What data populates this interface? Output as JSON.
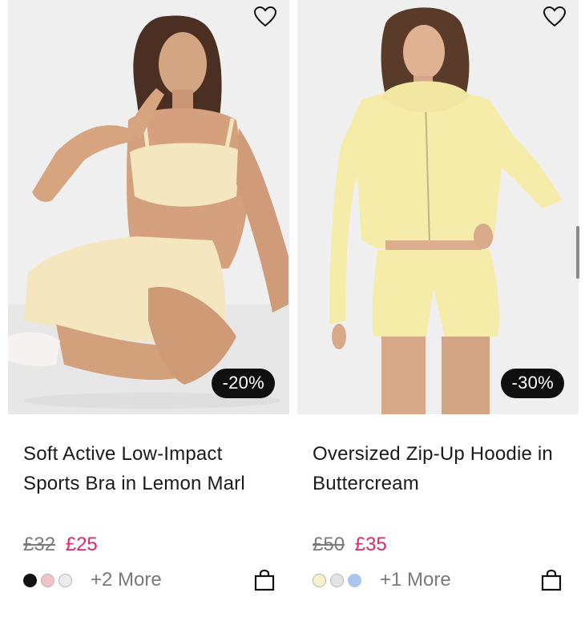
{
  "products": [
    {
      "title": "Soft Active Low-Impact Sports Bra in Lemon Marl",
      "discount_badge": "-20%",
      "old_price": "£32",
      "new_price": "£25",
      "swatches": [
        "#111111",
        "#f1c3c6",
        "#ececec"
      ],
      "more_colors": "+2 More",
      "icons": [
        "heart-outline-icon",
        "shopping-bag-icon"
      ]
    },
    {
      "title": "Oversized Zip-Up Hoodie in Buttercream",
      "discount_badge": "-30%",
      "old_price": "£50",
      "new_price": "£35",
      "swatches": [
        "#f8f0c9",
        "#e3e3e3",
        "#a9c7ea"
      ],
      "more_colors": "+1 More",
      "icons": [
        "heart-outline-icon",
        "shopping-bag-icon"
      ]
    }
  ],
  "colors": {
    "sale_price": "#e2266a",
    "badge_bg": "#0f0f0f",
    "old_price": "#7a7a7a"
  }
}
